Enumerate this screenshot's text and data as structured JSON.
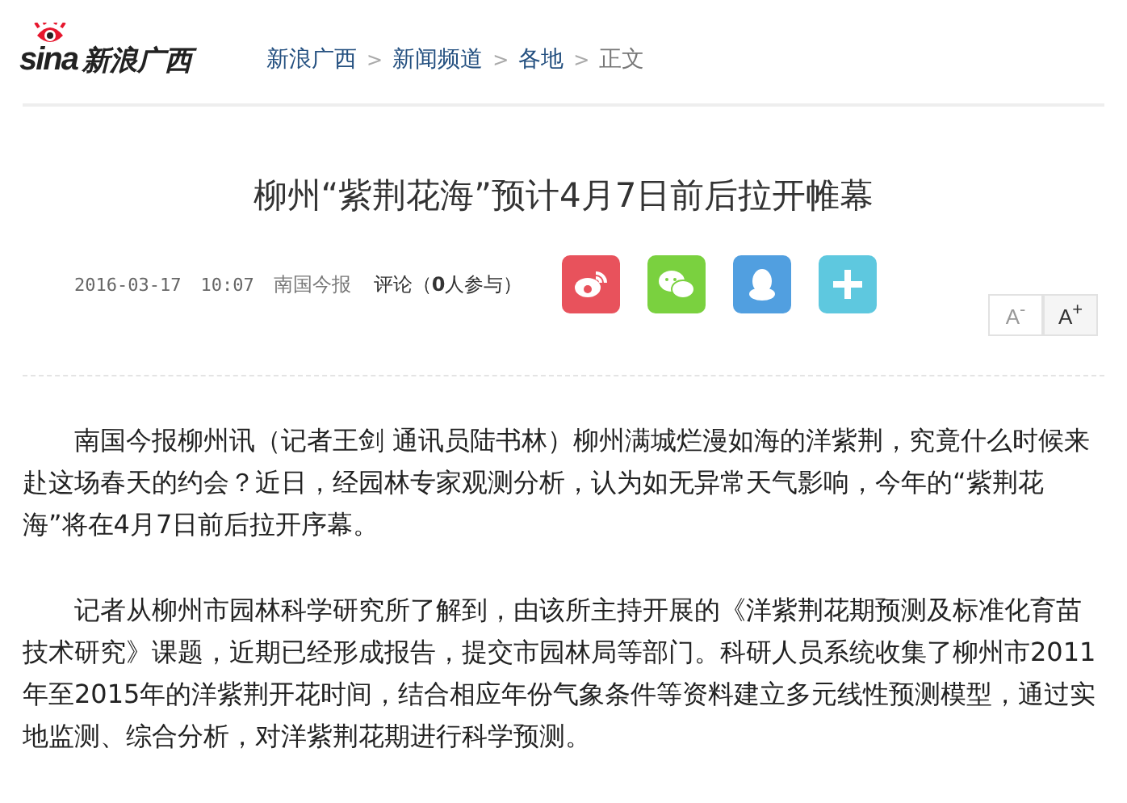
{
  "header": {
    "logo_text": "sina",
    "site_name": "新浪广西",
    "breadcrumbs": [
      "新浪广西",
      "新闻频道",
      "各地",
      "正文"
    ],
    "breadcrumb_separator": ">"
  },
  "article": {
    "title": "柳州“紫荆花海”预计4月7日前后拉开帷幕",
    "date": "2016-03-17",
    "time": "10:07",
    "source": "南国今报",
    "comments": "评论（**0**人参与）",
    "share_buttons": [
      {
        "kind": "weibo",
        "color": "#e8525c"
      },
      {
        "kind": "wechat",
        "color": "#7ad13f"
      },
      {
        "kind": "qq",
        "color": "#519fe0"
      },
      {
        "kind": "more",
        "color": "#5ec8df"
      }
    ],
    "font_buttons": [
      {
        "letter": "A",
        "sign": "-",
        "selected": false
      },
      {
        "letter": "A",
        "sign": "+",
        "selected": true
      }
    ],
    "paragraphs": [
      "南国今报柳州讯（记者王剑 通讯员陆书林）柳州满城烂漫如海的洋紫荆，究竟什么时候来赴这场春天的约会？近日，经园林专家观测分析，认为如无异常天气影响，今年的“紫荆花海”将在4月7日前后拉开序幕。",
      "记者从柳州市园林科学研究所了解到，由该所主持开展的《洋紫荆花期预测及标准化育苗技术研究》课题，近期已经形成报告，提交市园林局等部门。科研人员系统收集了柳州市2011年至2015年的洋紫荆开花时间，结合相应年份气象条件等资料建立多元线性预测模型，通过实地监测、综合分析，对洋紫荆花期进行科学预测。"
    ]
  }
}
